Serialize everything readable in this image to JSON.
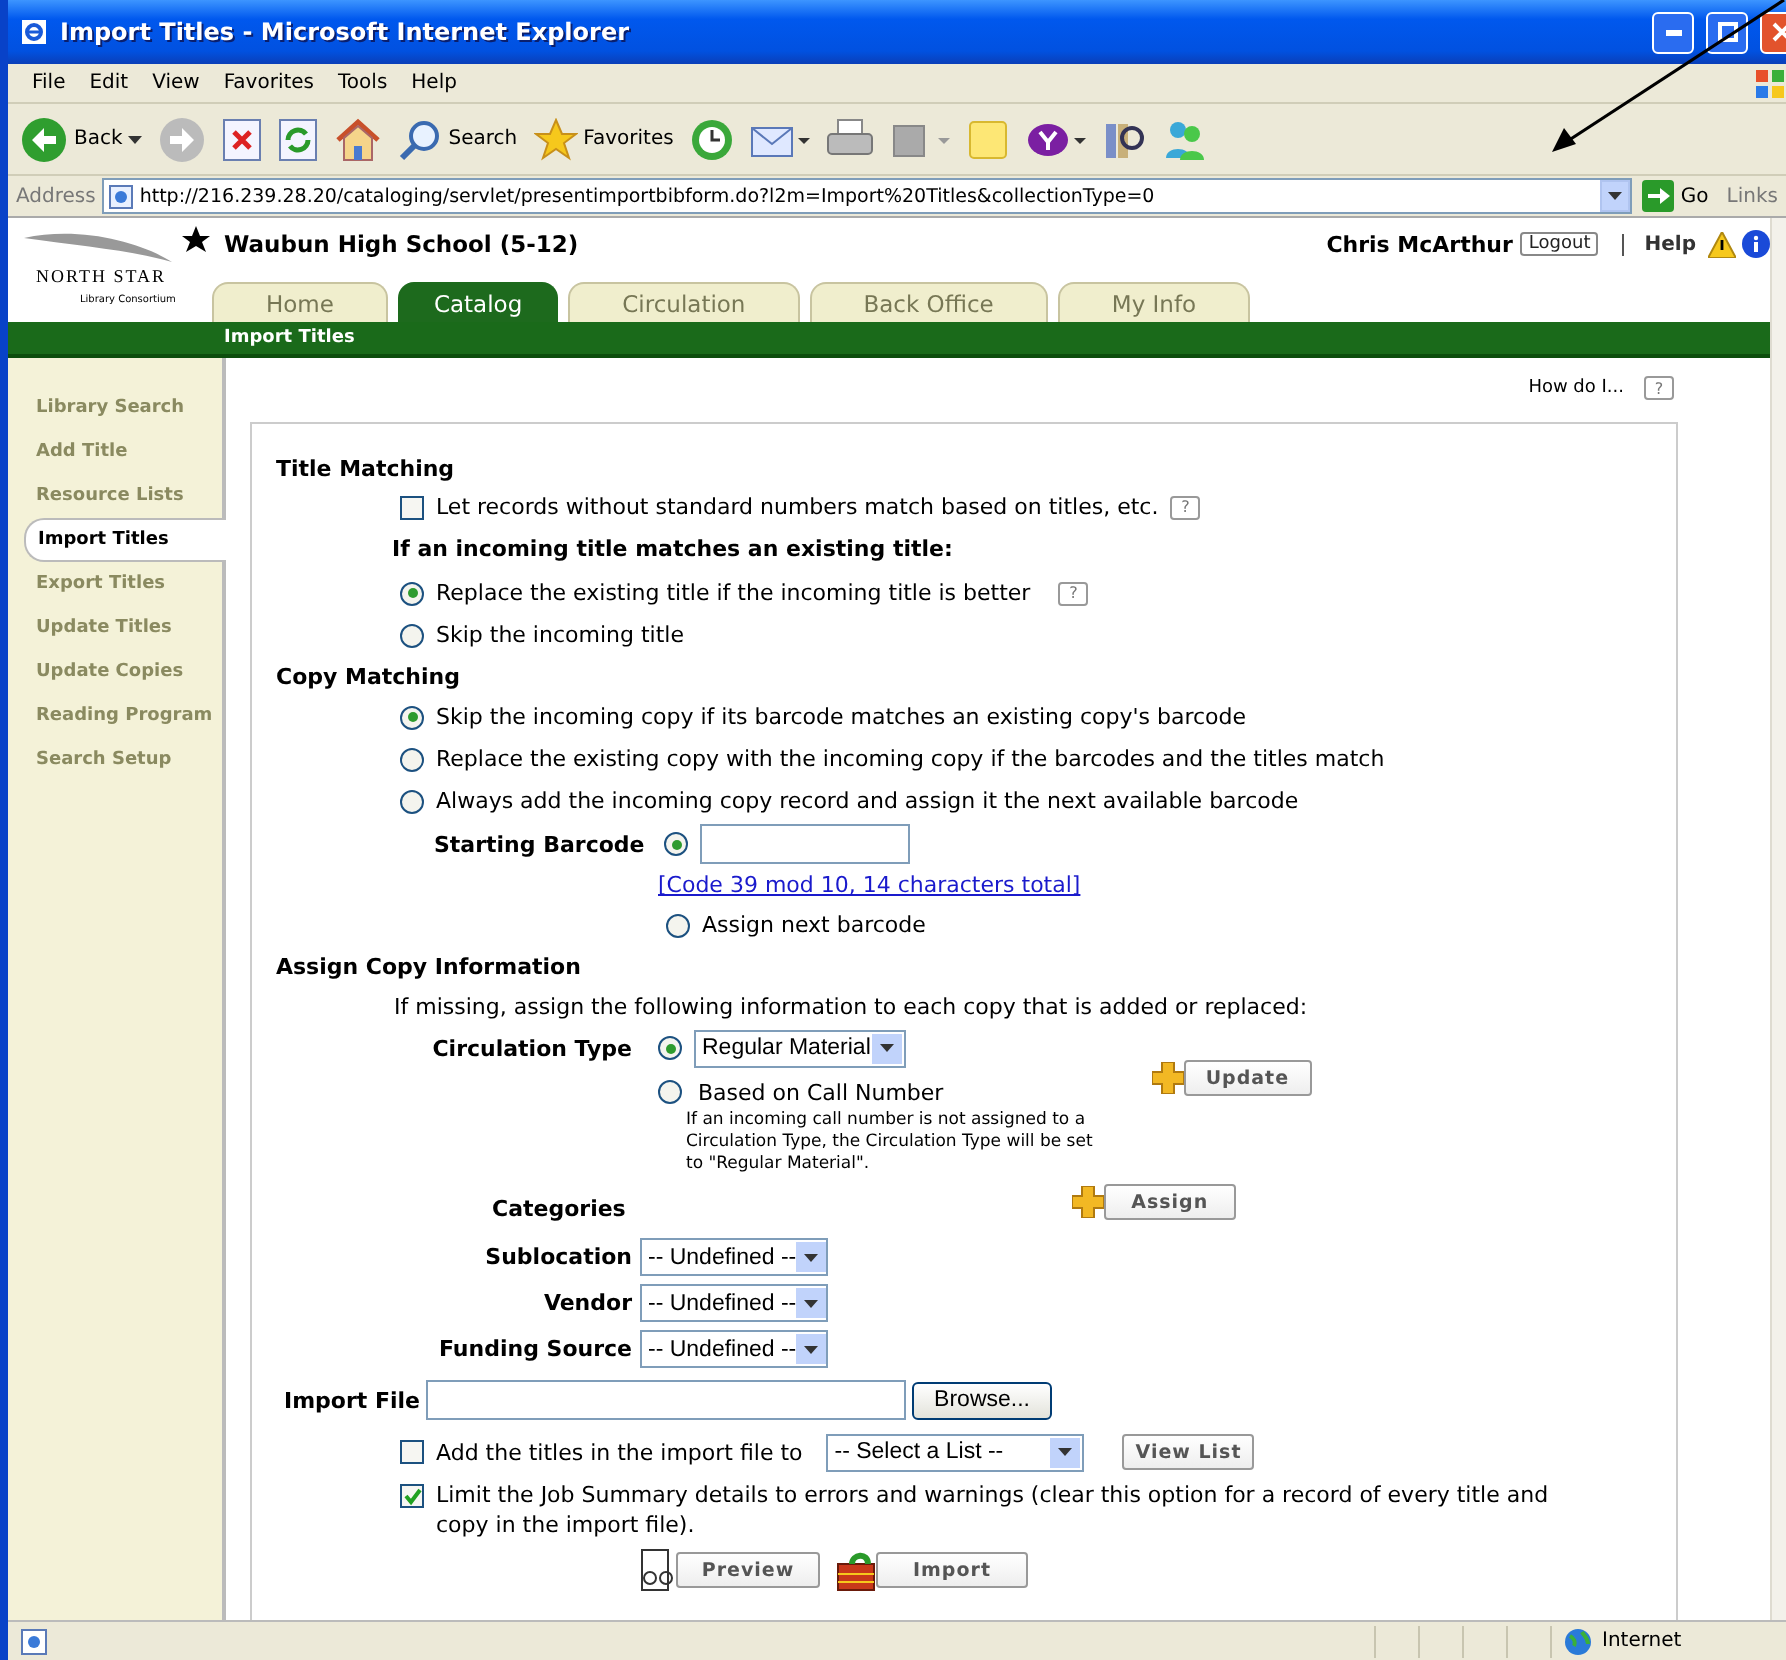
{
  "window": {
    "title": "Import Titles - Microsoft Internet Explorer"
  },
  "menu": [
    "File",
    "Edit",
    "View",
    "Favorites",
    "Tools",
    "Help"
  ],
  "toolbar": [
    {
      "kind": "back",
      "label": "Back"
    },
    {
      "kind": "forward"
    },
    {
      "kind": "stop"
    },
    {
      "kind": "refresh"
    },
    {
      "kind": "home"
    },
    {
      "kind": "search",
      "label": "Search"
    },
    {
      "kind": "favorites",
      "label": "Favorites"
    },
    {
      "kind": "history"
    },
    {
      "kind": "mail"
    },
    {
      "kind": "print"
    },
    {
      "kind": "edit"
    },
    {
      "kind": "note"
    },
    {
      "kind": "yahoo"
    },
    {
      "kind": "research"
    },
    {
      "kind": "messenger"
    }
  ],
  "address": {
    "label": "Address",
    "url": "http://216.239.28.20/cataloging/servlet/presentimportbibform.do?l2m=Import%20Titles&collectionType=0",
    "go": "Go",
    "links": "Links"
  },
  "header": {
    "logo_top": "NORTH STAR",
    "logo_bottom": "Library Consortium",
    "school": "Waubun High School (5-12)",
    "user": "Chris McArthur",
    "logout": "Logout",
    "help": "Help"
  },
  "tabs": [
    {
      "label": "Home",
      "selected": false
    },
    {
      "label": "Catalog",
      "selected": true
    },
    {
      "label": "Circulation",
      "selected": false
    },
    {
      "label": "Back Office",
      "selected": false
    },
    {
      "label": "My Info",
      "selected": false
    }
  ],
  "breadcrumb": "Import Titles",
  "sidebar": [
    {
      "label": "Library Search",
      "selected": false
    },
    {
      "label": "Add Title",
      "selected": false
    },
    {
      "label": "Resource Lists",
      "selected": false
    },
    {
      "label": "Import Titles",
      "selected": true
    },
    {
      "label": "Export Titles",
      "selected": false
    },
    {
      "label": "Update Titles",
      "selected": false
    },
    {
      "label": "Update Copies",
      "selected": false
    },
    {
      "label": "Reading Program",
      "selected": false
    },
    {
      "label": "Search Setup",
      "selected": false
    }
  ],
  "how_do_i": {
    "label": "How do I...",
    "help": "?"
  },
  "title_matching": {
    "heading": "Title Matching",
    "match_titles": {
      "label": "Let records without standard numbers match based on titles, etc.",
      "checked": false,
      "help": "?"
    },
    "question": "If an incoming title matches an existing title:",
    "options": [
      {
        "label": "Replace the existing title if the incoming title is better",
        "selected": true,
        "help": "?"
      },
      {
        "label": "Skip the incoming title",
        "selected": false
      }
    ]
  },
  "copy_matching": {
    "heading": "Copy Matching",
    "options": [
      {
        "label": "Skip the incoming copy if its barcode matches an existing copy's barcode",
        "selected": true
      },
      {
        "label": "Replace the existing copy with the incoming copy if the barcodes and the titles match",
        "selected": false
      },
      {
        "label": "Always add the incoming copy record and assign it the next available barcode",
        "selected": false
      }
    ],
    "starting_barcode": {
      "label": "Starting Barcode",
      "selected": true,
      "format": "[Code 39 mod 10, 14 characters total]"
    },
    "assign_next": {
      "label": "Assign next barcode",
      "selected": false
    }
  },
  "copy_info": {
    "heading": "Assign Copy Information",
    "intro": "If missing, assign the following information to each copy that is added or replaced:",
    "circulation_type": {
      "label": "Circulation Type",
      "choices": [
        {
          "kind": "select",
          "value": "Regular Material",
          "selected": true
        },
        {
          "kind": "text",
          "label": "Based on Call Number",
          "selected": false
        }
      ],
      "note": "If an incoming call number is not assigned to a Circulation Type, the Circulation Type will be set to \"Regular Material\".",
      "button": "Update"
    },
    "categories": {
      "label": "Categories",
      "button": "Assign",
      "fields": [
        {
          "label": "Sublocation",
          "value": "-- Undefined --"
        },
        {
          "label": "Vendor",
          "value": "-- Undefined --"
        },
        {
          "label": "Funding Source",
          "value": "-- Undefined --"
        }
      ]
    }
  },
  "import": {
    "file_label": "Import File",
    "browse": "Browse...",
    "add_to_list": {
      "label": "Add the titles in the import file to",
      "checked": false,
      "list": "-- Select a List --",
      "button": "View List"
    },
    "limit": {
      "label": "Limit the Job Summary details to errors and warnings (clear this option for a record of every title and copy in the import file).",
      "checked": true
    },
    "actions": [
      {
        "kind": "preview",
        "label": "Preview"
      },
      {
        "kind": "import",
        "label": "Import"
      }
    ]
  },
  "status_bar": {
    "zone": "Internet"
  }
}
